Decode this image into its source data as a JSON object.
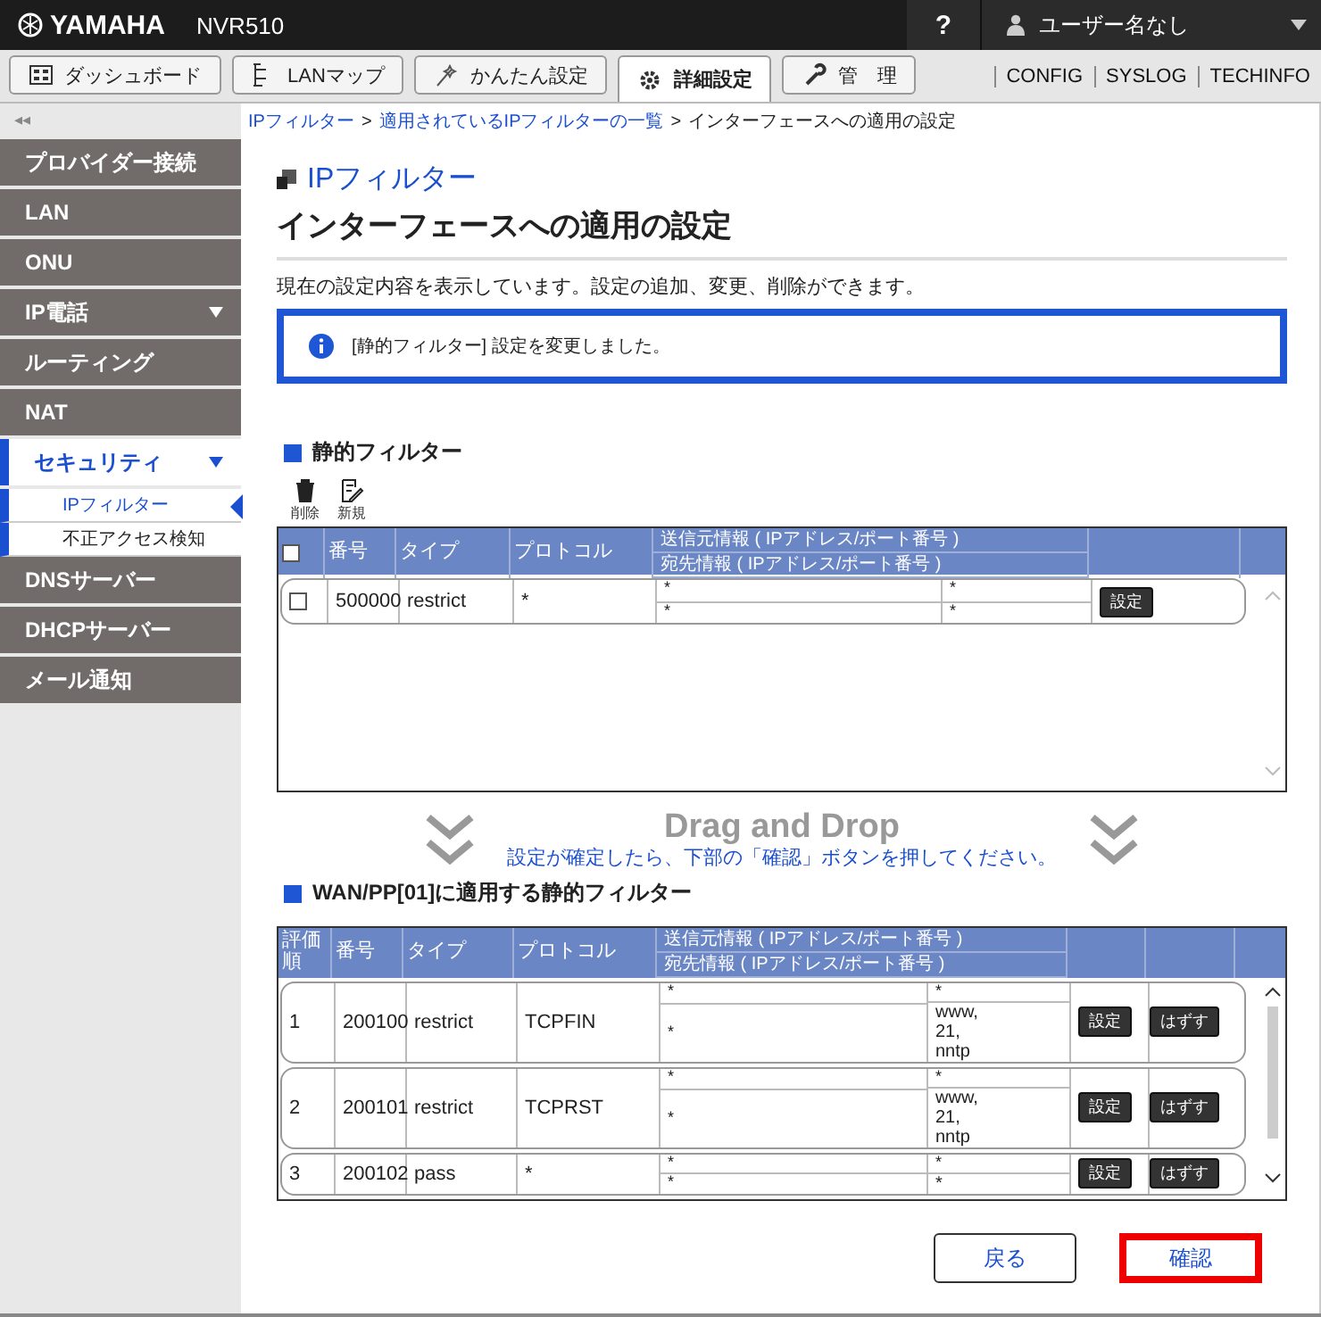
{
  "header": {
    "brand": "YAMAHA",
    "model": "NVR510",
    "help": "?",
    "user": "ユーザー名なし"
  },
  "nav_tabs": [
    {
      "label": "ダッシュボード",
      "selected": false
    },
    {
      "label": "LANマップ",
      "selected": false
    },
    {
      "label": "かんたん設定",
      "selected": false
    },
    {
      "label": "詳細設定",
      "selected": true
    },
    {
      "label": "管　理",
      "selected": false
    }
  ],
  "nav_links": [
    "CONFIG",
    "SYSLOG",
    "TECHINFO"
  ],
  "collapse": "◂◂",
  "breadcrumb": [
    {
      "label": "IPフィルター",
      "link": true
    },
    {
      "label": "適用されているIPフィルターの一覧",
      "link": true
    },
    {
      "label": "インターフェースへの適用の設定",
      "link": false
    }
  ],
  "breadcrumb_separator": ">",
  "sidebar": {
    "items": [
      {
        "label": "プロバイダー接続",
        "selected": false
      },
      {
        "label": "LAN",
        "selected": false
      },
      {
        "label": "ONU",
        "selected": false
      },
      {
        "label": "IP電話",
        "selected": false,
        "expandable": true
      },
      {
        "label": "ルーティング",
        "selected": false
      },
      {
        "label": "NAT",
        "selected": false
      },
      {
        "label": "セキュリティ",
        "selected": true,
        "expandable": true,
        "children": [
          {
            "label": "IPフィルター",
            "selected": true
          },
          {
            "label": "不正アクセス検知",
            "selected": false
          }
        ]
      },
      {
        "label": "DNSサーバー",
        "selected": false
      },
      {
        "label": "DHCPサーバー",
        "selected": false
      },
      {
        "label": "メール通知",
        "selected": false
      }
    ]
  },
  "page": {
    "section": "IPフィルター",
    "title": "インターフェースへの適用の設定",
    "description": "現在の設定内容を表示しています。設定の追加、変更、削除ができます。",
    "notice": "[静的フィルター] 設定を変更しました。"
  },
  "static_filter": {
    "heading": "静的フィルター",
    "tools": [
      "削除",
      "新規"
    ],
    "all_checked": false,
    "columns": [
      "番号",
      "タイプ",
      "プロトコル"
    ],
    "info_headers": [
      "送信元情報 ( IPアドレス/ポート番号 )",
      "宛先情報 ( IPアドレス/ポート番号 )"
    ],
    "rows": [
      {
        "checked": false,
        "number": "500000",
        "type": "restrict",
        "protocol": "*",
        "src_address": "*",
        "src_port": "*",
        "dst_address": "*",
        "dst_port": "*",
        "button": "設定"
      }
    ]
  },
  "drag": {
    "title": "Drag and Drop",
    "hint": "設定が確定したら、下部の「確認」ボタンを押してください。"
  },
  "wan_filter": {
    "heading": "WAN/PP[01]に適用する静的フィルター",
    "columns": [
      "評価順",
      "番号",
      "タイプ",
      "プロトコル"
    ],
    "info_headers": [
      "送信元情報 ( IPアドレス/ポート番号 )",
      "宛先情報 ( IPアドレス/ポート番号 )"
    ],
    "rows": [
      {
        "order": "1",
        "number": "200100",
        "type": "restrict",
        "protocol": "TCPFIN",
        "src_address": "*",
        "src_port": "*",
        "dst_address": "*",
        "dst_port": "www,\n21,\nnntp",
        "edit": "設定",
        "remove": "はずす"
      },
      {
        "order": "2",
        "number": "200101",
        "type": "restrict",
        "protocol": "TCPRST",
        "src_address": "*",
        "src_port": "*",
        "dst_address": "*",
        "dst_port": "www,\n21,\nnntp",
        "edit": "設定",
        "remove": "はずす"
      },
      {
        "order": "3",
        "number": "200102",
        "type": "pass",
        "protocol": "*",
        "src_address": "*",
        "src_port": "*",
        "dst_address": "*",
        "dst_port": "*",
        "edit": "設定",
        "remove": "はずす"
      }
    ]
  },
  "buttons": [
    {
      "label": "戻る",
      "highlighted": false
    },
    {
      "label": "確認",
      "highlighted": true
    }
  ]
}
